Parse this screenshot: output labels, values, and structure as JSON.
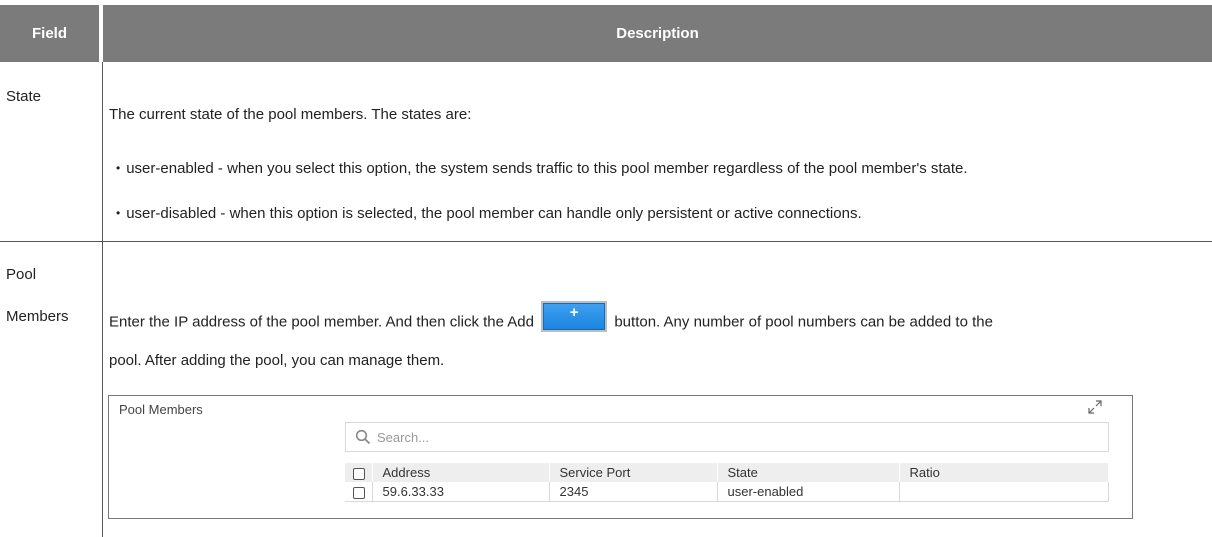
{
  "table_header": {
    "field": "Field",
    "description": "Description"
  },
  "rows": [
    {
      "label": "State",
      "intro": "The current state of the pool members. The states are:",
      "bullets": [
        "user-enabled - when you select this option, the system sends traffic to this pool member regardless of the pool member's state.",
        "user-disabled - when this option is selected, the pool member can handle only persistent or active connections."
      ]
    },
    {
      "label_line1": "Pool",
      "label_line2": "Members",
      "text_before": "Enter the IP address of the pool member. And then click the Add",
      "add_button_glyph": "+",
      "text_after": "button. Any number of pool numbers can be added to the",
      "text_line2": "pool. After adding the pool, you can manage them."
    }
  ],
  "pool_panel": {
    "title": "Pool Members",
    "search_placeholder": "Search...",
    "columns": [
      "Address",
      "Service Port",
      "State",
      "Ratio"
    ],
    "rows": [
      {
        "address": "59.6.33.33",
        "service_port": "2345",
        "state": "user-enabled",
        "ratio": ""
      }
    ]
  }
}
